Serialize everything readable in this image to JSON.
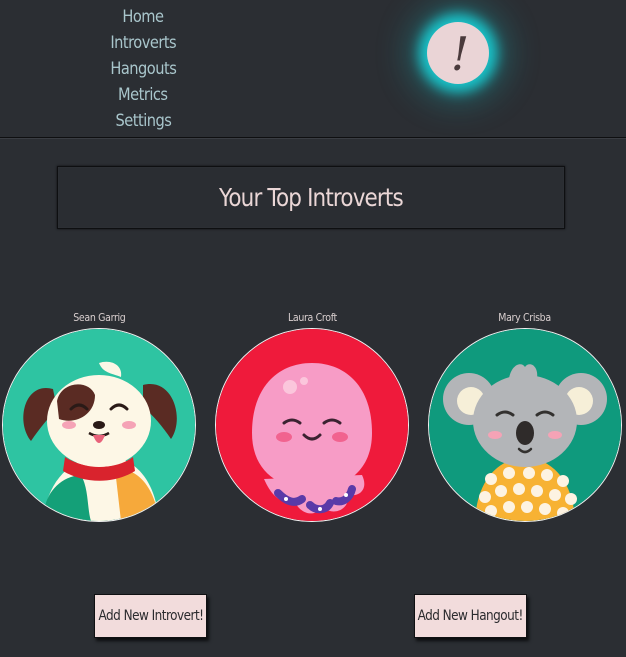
{
  "nav": {
    "items": [
      {
        "label": "Home"
      },
      {
        "label": "Introverts"
      },
      {
        "label": "Hangouts"
      },
      {
        "label": "Metrics"
      },
      {
        "label": "Settings"
      }
    ]
  },
  "logo": {
    "glyph": "!",
    "icon": "exclamation-logo-icon",
    "glow_color": "#19c3c9",
    "fill_color": "#ead4d6"
  },
  "main": {
    "title": "Your Top Introverts"
  },
  "introverts": [
    {
      "name": "Sean Garrig",
      "avatar": "dog-avatar-icon",
      "bg": "#2ec4a2"
    },
    {
      "name": "Laura Croft",
      "avatar": "octopus-avatar-icon",
      "bg": "#ef1a3b"
    },
    {
      "name": "Mary Crisba",
      "avatar": "koala-avatar-icon",
      "bg": "#0f9a7d"
    }
  ],
  "actions": {
    "add_introvert": "Add New Introvert!",
    "add_hangout": "Add New Hangout!"
  },
  "colors": {
    "background": "#2b2e33",
    "nav_text": "#a9c6cc",
    "button_bg": "#f2dcdc"
  }
}
